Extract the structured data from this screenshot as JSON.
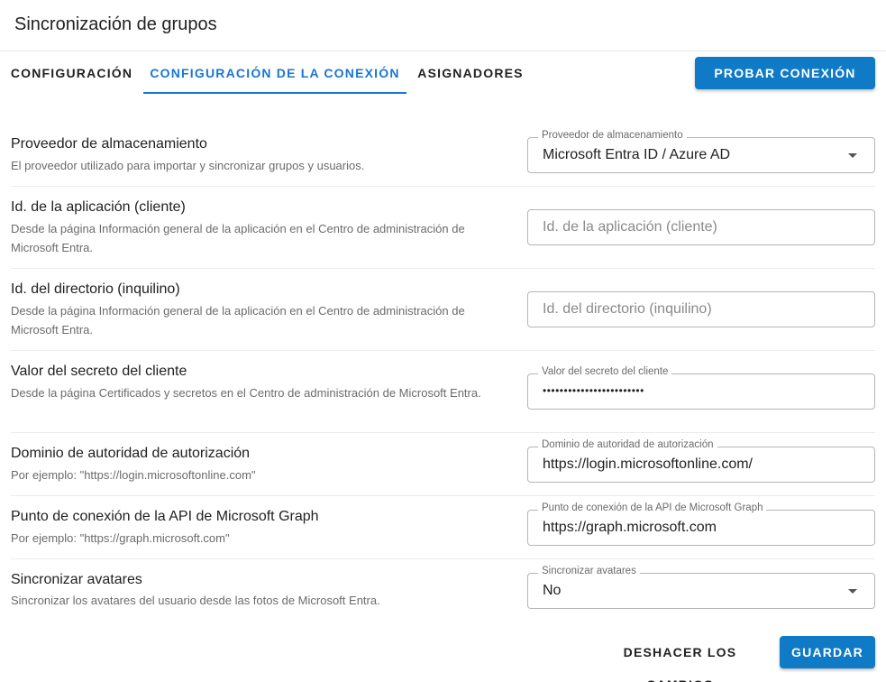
{
  "page": {
    "title": "Sincronización de grupos"
  },
  "tabs": [
    {
      "label": "CONFIGURACIÓN",
      "active": false
    },
    {
      "label": "CONFIGURACIÓN DE LA CONEXIÓN",
      "active": true
    },
    {
      "label": "ASIGNADORES",
      "active": false
    }
  ],
  "actions": {
    "test_connection": "PROBAR CONEXIÓN",
    "discard": "DESHACER LOS CAMBIOS",
    "save": "GUARDAR"
  },
  "settings": {
    "provider": {
      "label": "Proveedor de almacenamiento",
      "description": "El proveedor utilizado para importar y sincronizar grupos y usuarios.",
      "field_label": "Proveedor de almacenamiento",
      "value": "Microsoft Entra ID / Azure AD"
    },
    "client_id": {
      "label": "Id. de la aplicación (cliente)",
      "description": "Desde la página Información general de la aplicación en el Centro de administración de Microsoft Entra.",
      "placeholder": "Id. de la aplicación (cliente)"
    },
    "tenant_id": {
      "label": "Id. del directorio (inquilino)",
      "description": "Desde la página Información general de la aplicación en el Centro de administración de Microsoft Entra.",
      "placeholder": "Id. del directorio (inquilino)"
    },
    "client_secret": {
      "label": "Valor del secreto del cliente",
      "description": "Desde la página Certificados y secretos en el Centro de administración de Microsoft Entra.",
      "field_label": "Valor del secreto del cliente",
      "value": "••••••••••••••••••••••••"
    },
    "authority": {
      "label": "Dominio de autoridad de autorización",
      "description": "Por ejemplo: \"https://login.microsoftonline.com\"",
      "field_label": "Dominio de autoridad de autorización",
      "value": "https://login.microsoftonline.com/"
    },
    "graph_endpoint": {
      "label": "Punto de conexión de la API de Microsoft Graph",
      "description": "Por ejemplo: \"https://graph.microsoft.com\"",
      "field_label": "Punto de conexión de la API de Microsoft Graph",
      "value": "https://graph.microsoft.com"
    },
    "sync_avatars": {
      "label": "Sincronizar avatares",
      "description": "Sincronizar los avatares del usuario desde las fotos de Microsoft Entra.",
      "field_label": "Sincronizar avatares",
      "value": "No"
    }
  },
  "colors": {
    "accent": "#1976d2",
    "button": "#0f7ac6"
  }
}
